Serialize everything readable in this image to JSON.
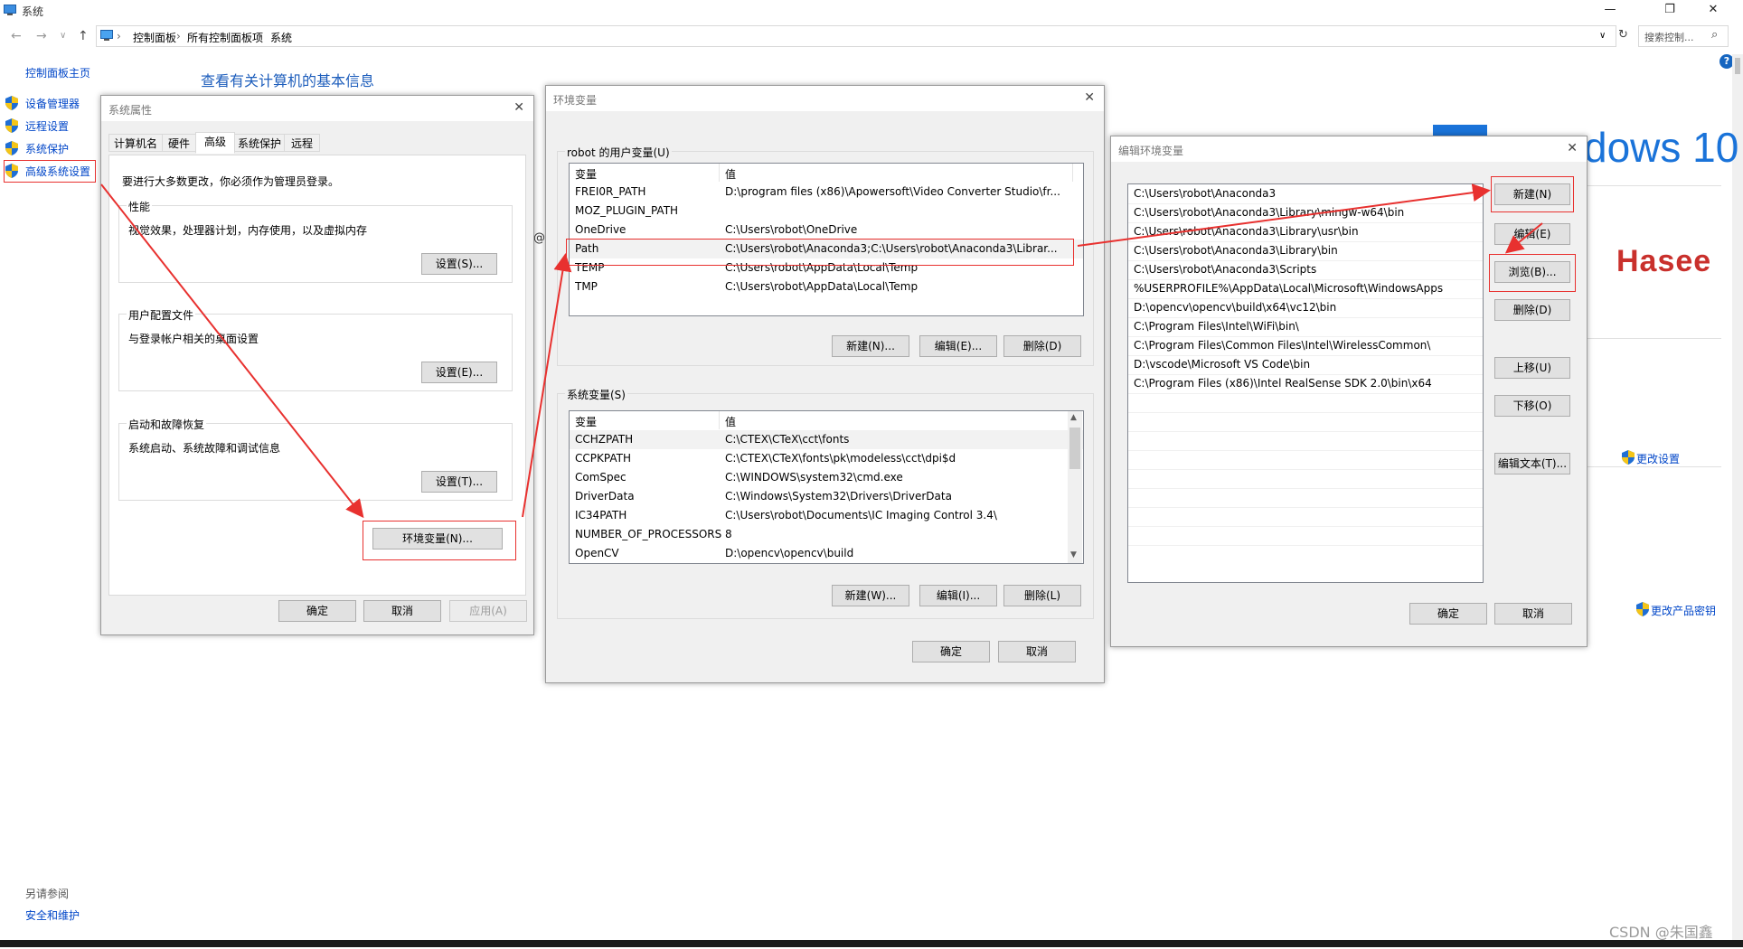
{
  "window": {
    "title": "系统",
    "minimize": "—",
    "maximize": "❐",
    "close": "✕"
  },
  "address": {
    "crumbs": [
      "控制面板",
      "所有控制面板项",
      "系统"
    ],
    "sep": "›",
    "search_placeholder": "搜索控制...",
    "dropdown": "∨",
    "refresh": "↻",
    "back": "←",
    "forward": "→",
    "up": "↑",
    "history": "∨",
    "search_glyph": "⌕",
    "help": "?"
  },
  "leftnav": {
    "home": "控制面板主页",
    "items": [
      "设备管理器",
      "远程设置",
      "系统保护",
      "高级系统设置"
    ],
    "see_also": "另请参阅",
    "security": "安全和维护"
  },
  "main": {
    "heading": "查看有关计算机的基本信息",
    "brand_text": "dows 10",
    "hasee": "Hasee",
    "change_settings": "更改设置",
    "change_key": "更改产品密钥",
    "at_sign": "@"
  },
  "sysprops": {
    "title": "系统属性",
    "tabs": [
      "计算机名",
      "硬件",
      "高级",
      "系统保护",
      "远程"
    ],
    "admin_note": "要进行大多数更改，你必须作为管理员登录。",
    "perf_label": "性能",
    "perf_desc": "视觉效果，处理器计划，内存使用，以及虚拟内存",
    "perf_btn": "设置(S)...",
    "profile_label": "用户配置文件",
    "profile_desc": "与登录帐户相关的桌面设置",
    "profile_btn": "设置(E)...",
    "startup_label": "启动和故障恢复",
    "startup_desc": "系统启动、系统故障和调试信息",
    "startup_btn": "设置(T)...",
    "env_btn": "环境变量(N)...",
    "ok": "确定",
    "cancel": "取消",
    "apply": "应用(A)"
  },
  "envvars": {
    "title": "环境变量",
    "user_label": "robot 的用户变量(U)",
    "col_var": "变量",
    "col_val": "值",
    "user_vars": [
      {
        "name": "FREI0R_PATH",
        "value": "D:\\program files (x86)\\Apowersoft\\Video Converter Studio\\fr..."
      },
      {
        "name": "MOZ_PLUGIN_PATH",
        "value": ""
      },
      {
        "name": "OneDrive",
        "value": "C:\\Users\\robot\\OneDrive"
      },
      {
        "name": "Path",
        "value": "C:\\Users\\robot\\Anaconda3;C:\\Users\\robot\\Anaconda3\\Librar..."
      },
      {
        "name": "TEMP",
        "value": "C:\\Users\\robot\\AppData\\Local\\Temp"
      },
      {
        "name": "TMP",
        "value": "C:\\Users\\robot\\AppData\\Local\\Temp"
      }
    ],
    "user_new": "新建(N)...",
    "user_edit": "编辑(E)...",
    "user_delete": "删除(D)",
    "sys_label": "系统变量(S)",
    "sys_vars": [
      {
        "name": "CCHZPATH",
        "value": "C:\\CTEX\\CTeX\\cct\\fonts"
      },
      {
        "name": "CCPKPATH",
        "value": "C:\\CTEX\\CTeX\\fonts\\pk\\modeless\\cct\\dpi$d"
      },
      {
        "name": "ComSpec",
        "value": "C:\\WINDOWS\\system32\\cmd.exe"
      },
      {
        "name": "DriverData",
        "value": "C:\\Windows\\System32\\Drivers\\DriverData"
      },
      {
        "name": "IC34PATH",
        "value": "C:\\Users\\robot\\Documents\\IC Imaging Control 3.4\\"
      },
      {
        "name": "NUMBER_OF_PROCESSORS",
        "value": "8"
      },
      {
        "name": "OpenCV",
        "value": "D:\\opencv\\opencv\\build"
      }
    ],
    "sys_new": "新建(W)...",
    "sys_edit": "编辑(I)...",
    "sys_delete": "删除(L)",
    "ok": "确定",
    "cancel": "取消",
    "scroll_up": "▲",
    "scroll_down": "▼"
  },
  "editenv": {
    "title": "编辑环境变量",
    "entries": [
      "C:\\Users\\robot\\Anaconda3",
      "C:\\Users\\robot\\Anaconda3\\Library\\mingw-w64\\bin",
      "C:\\Users\\robot\\Anaconda3\\Library\\usr\\bin",
      "C:\\Users\\robot\\Anaconda3\\Library\\bin",
      "C:\\Users\\robot\\Anaconda3\\Scripts",
      "%USERPROFILE%\\AppData\\Local\\Microsoft\\WindowsApps",
      "D:\\opencv\\opencv\\build\\x64\\vc12\\bin",
      "C:\\Program Files\\Intel\\WiFi\\bin\\",
      "C:\\Program Files\\Common Files\\Intel\\WirelessCommon\\",
      "D:\\vscode\\Microsoft VS Code\\bin",
      "C:\\Program Files (x86)\\Intel RealSense SDK 2.0\\bin\\x64"
    ],
    "new": "新建(N)",
    "edit": "编辑(E)",
    "browse": "浏览(B)...",
    "delete": "删除(D)",
    "move_up": "上移(U)",
    "move_down": "下移(O)",
    "edit_text": "编辑文本(T)...",
    "ok": "确定",
    "cancel": "取消"
  },
  "watermark": "CSDN @朱国鑫",
  "colors": {
    "highlight": "#e8312f",
    "link": "#0046c8",
    "heading": "#1e5ebc"
  }
}
